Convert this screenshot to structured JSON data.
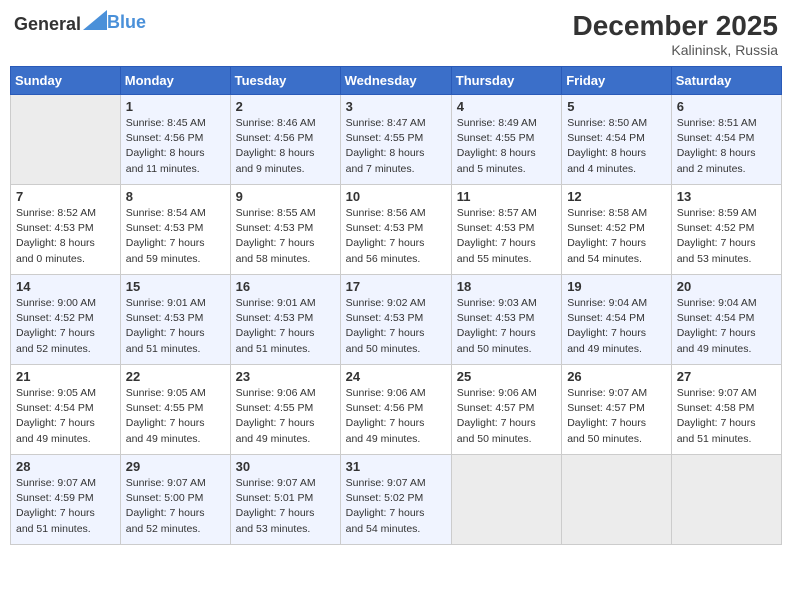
{
  "header": {
    "logo_general": "General",
    "logo_blue": "Blue",
    "month_title": "December 2025",
    "location": "Kalininsk, Russia"
  },
  "weekdays": [
    "Sunday",
    "Monday",
    "Tuesday",
    "Wednesday",
    "Thursday",
    "Friday",
    "Saturday"
  ],
  "weeks": [
    [
      {
        "day": "",
        "info": ""
      },
      {
        "day": "1",
        "info": "Sunrise: 8:45 AM\nSunset: 4:56 PM\nDaylight: 8 hours\nand 11 minutes."
      },
      {
        "day": "2",
        "info": "Sunrise: 8:46 AM\nSunset: 4:56 PM\nDaylight: 8 hours\nand 9 minutes."
      },
      {
        "day": "3",
        "info": "Sunrise: 8:47 AM\nSunset: 4:55 PM\nDaylight: 8 hours\nand 7 minutes."
      },
      {
        "day": "4",
        "info": "Sunrise: 8:49 AM\nSunset: 4:55 PM\nDaylight: 8 hours\nand 5 minutes."
      },
      {
        "day": "5",
        "info": "Sunrise: 8:50 AM\nSunset: 4:54 PM\nDaylight: 8 hours\nand 4 minutes."
      },
      {
        "day": "6",
        "info": "Sunrise: 8:51 AM\nSunset: 4:54 PM\nDaylight: 8 hours\nand 2 minutes."
      }
    ],
    [
      {
        "day": "7",
        "info": "Sunrise: 8:52 AM\nSunset: 4:53 PM\nDaylight: 8 hours\nand 0 minutes."
      },
      {
        "day": "8",
        "info": "Sunrise: 8:54 AM\nSunset: 4:53 PM\nDaylight: 7 hours\nand 59 minutes."
      },
      {
        "day": "9",
        "info": "Sunrise: 8:55 AM\nSunset: 4:53 PM\nDaylight: 7 hours\nand 58 minutes."
      },
      {
        "day": "10",
        "info": "Sunrise: 8:56 AM\nSunset: 4:53 PM\nDaylight: 7 hours\nand 56 minutes."
      },
      {
        "day": "11",
        "info": "Sunrise: 8:57 AM\nSunset: 4:53 PM\nDaylight: 7 hours\nand 55 minutes."
      },
      {
        "day": "12",
        "info": "Sunrise: 8:58 AM\nSunset: 4:52 PM\nDaylight: 7 hours\nand 54 minutes."
      },
      {
        "day": "13",
        "info": "Sunrise: 8:59 AM\nSunset: 4:52 PM\nDaylight: 7 hours\nand 53 minutes."
      }
    ],
    [
      {
        "day": "14",
        "info": "Sunrise: 9:00 AM\nSunset: 4:52 PM\nDaylight: 7 hours\nand 52 minutes."
      },
      {
        "day": "15",
        "info": "Sunrise: 9:01 AM\nSunset: 4:53 PM\nDaylight: 7 hours\nand 51 minutes."
      },
      {
        "day": "16",
        "info": "Sunrise: 9:01 AM\nSunset: 4:53 PM\nDaylight: 7 hours\nand 51 minutes."
      },
      {
        "day": "17",
        "info": "Sunrise: 9:02 AM\nSunset: 4:53 PM\nDaylight: 7 hours\nand 50 minutes."
      },
      {
        "day": "18",
        "info": "Sunrise: 9:03 AM\nSunset: 4:53 PM\nDaylight: 7 hours\nand 50 minutes."
      },
      {
        "day": "19",
        "info": "Sunrise: 9:04 AM\nSunset: 4:54 PM\nDaylight: 7 hours\nand 49 minutes."
      },
      {
        "day": "20",
        "info": "Sunrise: 9:04 AM\nSunset: 4:54 PM\nDaylight: 7 hours\nand 49 minutes."
      }
    ],
    [
      {
        "day": "21",
        "info": "Sunrise: 9:05 AM\nSunset: 4:54 PM\nDaylight: 7 hours\nand 49 minutes."
      },
      {
        "day": "22",
        "info": "Sunrise: 9:05 AM\nSunset: 4:55 PM\nDaylight: 7 hours\nand 49 minutes."
      },
      {
        "day": "23",
        "info": "Sunrise: 9:06 AM\nSunset: 4:55 PM\nDaylight: 7 hours\nand 49 minutes."
      },
      {
        "day": "24",
        "info": "Sunrise: 9:06 AM\nSunset: 4:56 PM\nDaylight: 7 hours\nand 49 minutes."
      },
      {
        "day": "25",
        "info": "Sunrise: 9:06 AM\nSunset: 4:57 PM\nDaylight: 7 hours\nand 50 minutes."
      },
      {
        "day": "26",
        "info": "Sunrise: 9:07 AM\nSunset: 4:57 PM\nDaylight: 7 hours\nand 50 minutes."
      },
      {
        "day": "27",
        "info": "Sunrise: 9:07 AM\nSunset: 4:58 PM\nDaylight: 7 hours\nand 51 minutes."
      }
    ],
    [
      {
        "day": "28",
        "info": "Sunrise: 9:07 AM\nSunset: 4:59 PM\nDaylight: 7 hours\nand 51 minutes."
      },
      {
        "day": "29",
        "info": "Sunrise: 9:07 AM\nSunset: 5:00 PM\nDaylight: 7 hours\nand 52 minutes."
      },
      {
        "day": "30",
        "info": "Sunrise: 9:07 AM\nSunset: 5:01 PM\nDaylight: 7 hours\nand 53 minutes."
      },
      {
        "day": "31",
        "info": "Sunrise: 9:07 AM\nSunset: 5:02 PM\nDaylight: 7 hours\nand 54 minutes."
      },
      {
        "day": "",
        "info": ""
      },
      {
        "day": "",
        "info": ""
      },
      {
        "day": "",
        "info": ""
      }
    ]
  ]
}
